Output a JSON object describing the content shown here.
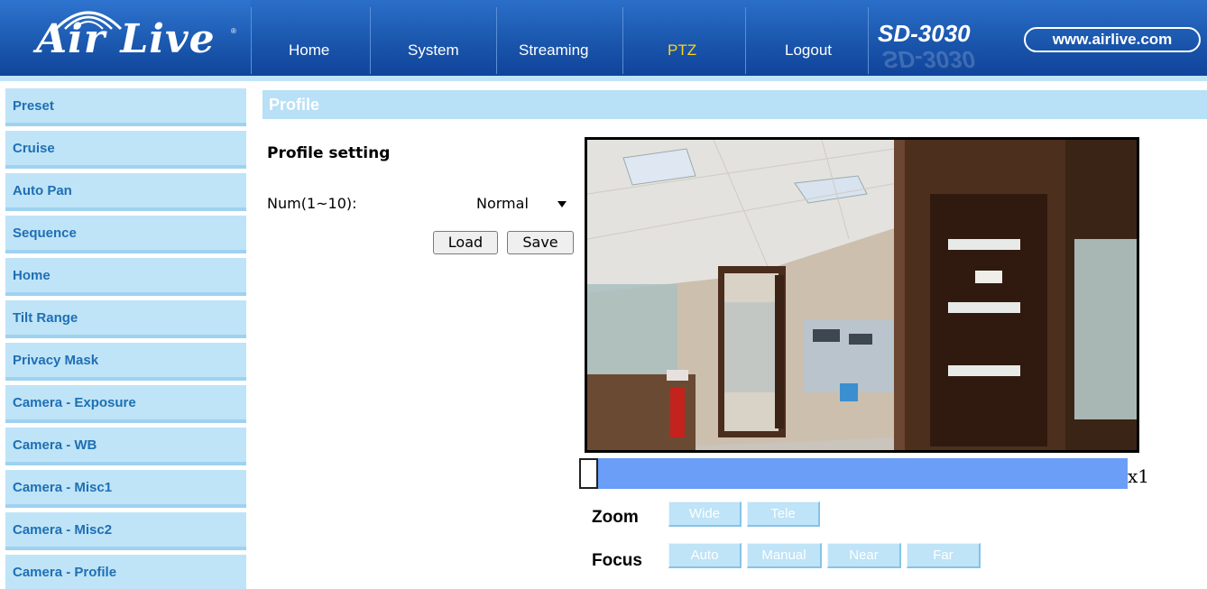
{
  "brand": {
    "logo_text": "Air Live",
    "reg_mark": "®"
  },
  "nav": {
    "items": [
      {
        "label": "Home"
      },
      {
        "label": "System"
      },
      {
        "label": "Streaming"
      },
      {
        "label": "PTZ"
      },
      {
        "label": "Logout"
      }
    ],
    "active": "PTZ"
  },
  "header": {
    "model": "SD-3030",
    "url": "www.airlive.com"
  },
  "sidebar": {
    "items": [
      {
        "label": "Preset"
      },
      {
        "label": "Cruise"
      },
      {
        "label": "Auto Pan"
      },
      {
        "label": "Sequence"
      },
      {
        "label": "Home"
      },
      {
        "label": "Tilt Range"
      },
      {
        "label": "Privacy Mask"
      },
      {
        "label": "Camera - Exposure"
      },
      {
        "label": "Camera - WB"
      },
      {
        "label": "Camera - Misc1"
      },
      {
        "label": "Camera - Misc2"
      },
      {
        "label": "Camera - Profile"
      }
    ]
  },
  "page": {
    "title": "Profile",
    "section_title": "Profile setting",
    "num_label": "Num(1~10):",
    "num_select": {
      "value": "Normal"
    },
    "load_label": "Load",
    "save_label": "Save"
  },
  "zoom": {
    "level_text": "x1",
    "level_fraction": 0.0
  },
  "controls": {
    "zoom_label": "Zoom",
    "wide_label": "Wide",
    "tele_label": "Tele",
    "focus_label": "Focus",
    "auto_label": "Auto",
    "manual_label": "Manual",
    "near_label": "Near",
    "far_label": "Far"
  },
  "colors": {
    "header_blue": "#1a56ac",
    "active_nav": "#ffd21c",
    "sidebar_bg": "#bfe4f7",
    "sidebar_text": "#1f6fb4",
    "profile_bar": "#b8e0f6",
    "zoom_track": "#6a9ef7",
    "control_button": "#bfe3f7"
  }
}
